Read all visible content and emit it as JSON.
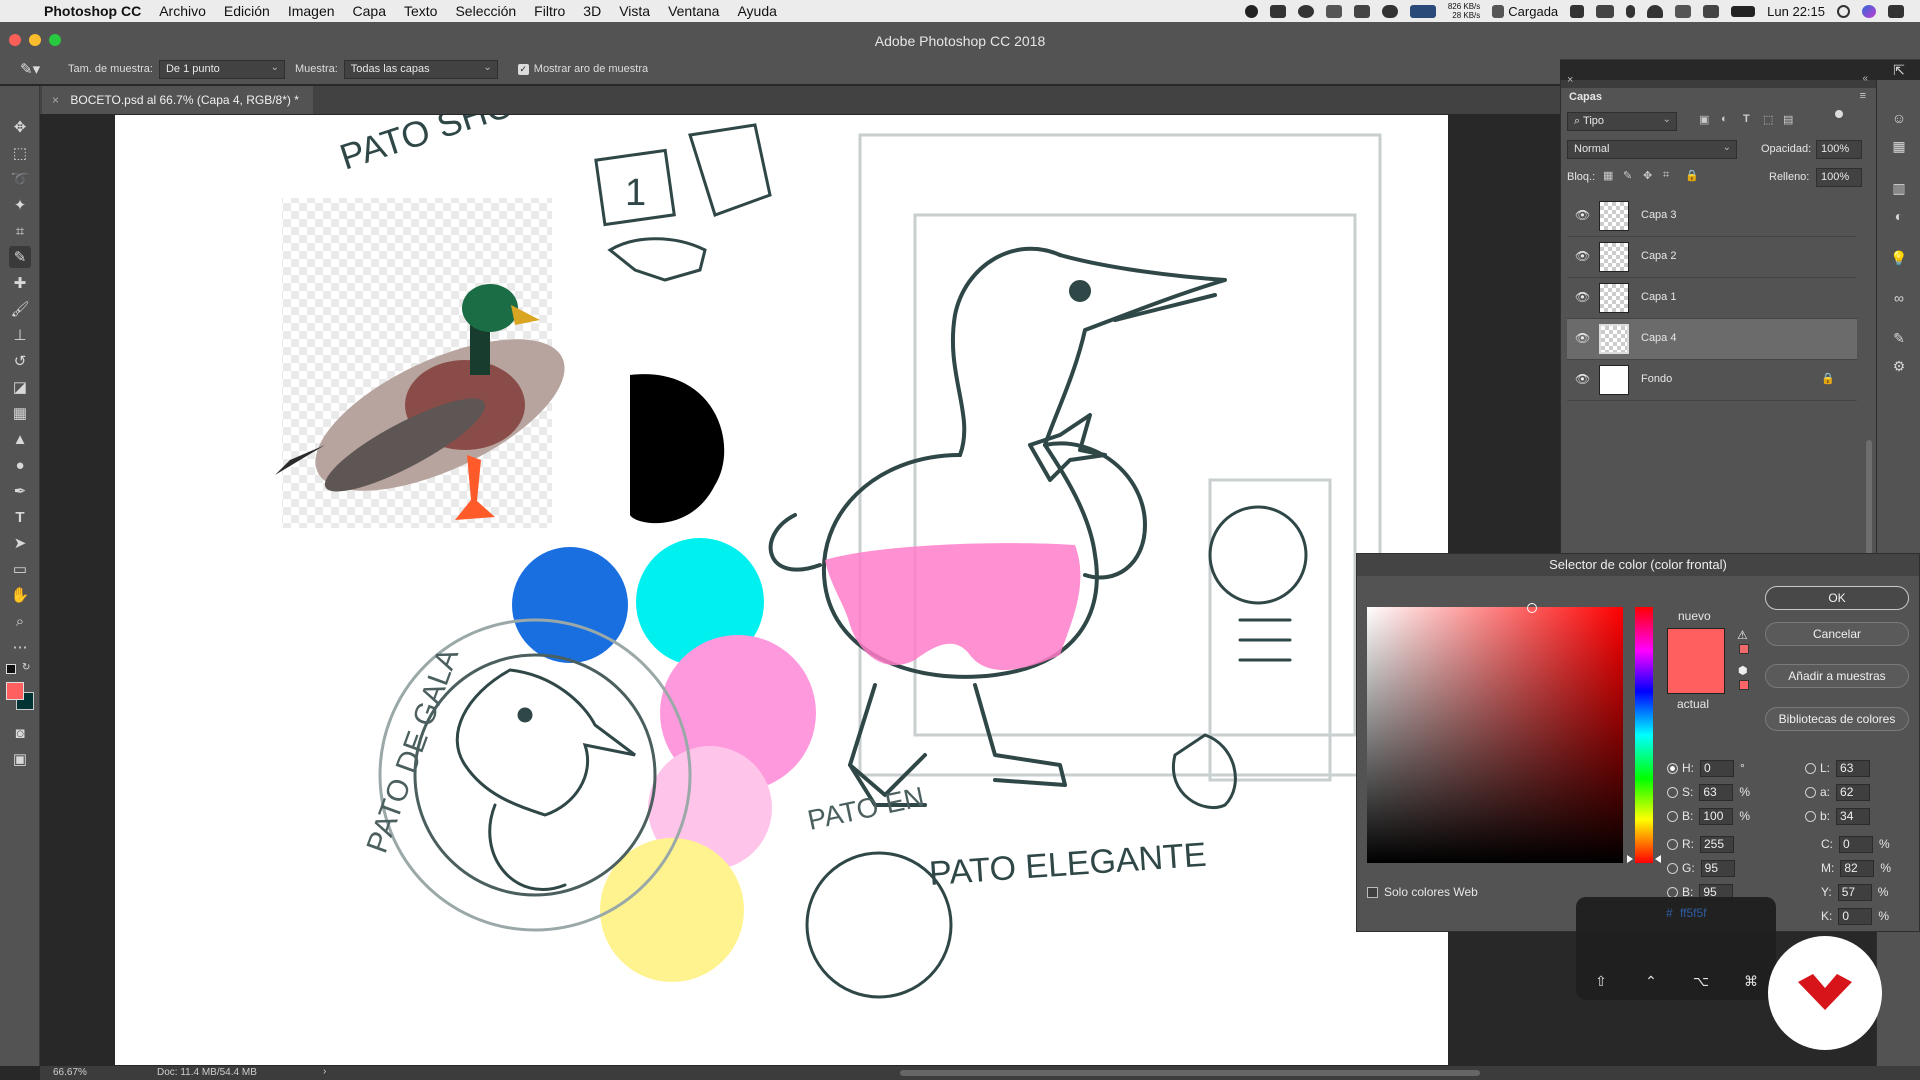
{
  "menubar": {
    "app_name": "Photoshop CC",
    "items": [
      "Archivo",
      "Edición",
      "Imagen",
      "Capa",
      "Texto",
      "Selección",
      "Filtro",
      "3D",
      "Vista",
      "Ventana",
      "Ayuda"
    ],
    "net_up": "826 KB/s",
    "net_down": "28 KB/s",
    "battery_label": "Cargada",
    "clock": "Lun 22:15"
  },
  "window": {
    "title": "Adobe Photoshop CC 2018"
  },
  "options": {
    "sample_size_label": "Tam. de muestra:",
    "sample_size_value": "De 1 punto",
    "sample_label": "Muestra:",
    "sample_value": "Todas las capas",
    "show_ring_label": "Mostrar aro de muestra",
    "show_ring_checked": true
  },
  "document": {
    "tab_title": "BOCETO.psd al 66.7% (Capa 4, RGB/8*) *"
  },
  "canvas_text": {
    "pato_short": "PATO SHORT",
    "pato_gala": "PATO DE GALA",
    "pato_elegante": "PATO ELEGANTE",
    "pato_en": "PATO EN",
    "pato_numero": "1"
  },
  "status": {
    "zoom": "66.67%",
    "doc_info": "Doc: 11.4 MB/54.4 MB"
  },
  "colors": {
    "foreground": "#ff5f5f",
    "background": "#003333",
    "blue": "#1a6fe0",
    "cyan": "#00f0f0",
    "pink": "#ff99dd",
    "light_pink": "#ffc4ea",
    "yellow": "#fff38f",
    "shorts_pink": "#ff7dc9",
    "sketch": "#2f4747"
  },
  "layers_panel": {
    "tab": "Capas",
    "filter": "Tipo",
    "blend_mode": "Normal",
    "opacity_label": "Opacidad:",
    "opacity": "100%",
    "lock_label": "Bloq.:",
    "fill_label": "Relleno:",
    "fill": "100%",
    "layers": [
      {
        "name": "Capa 3",
        "selected": false
      },
      {
        "name": "Capa 2",
        "selected": false
      },
      {
        "name": "Capa 1",
        "selected": false
      },
      {
        "name": "Capa 4",
        "selected": true
      },
      {
        "name": "Fondo",
        "selected": false,
        "locked": true
      }
    ]
  },
  "color_picker": {
    "title": "Selector de color (color frontal)",
    "new_label": "nuevo",
    "current_label": "actual",
    "ok": "OK",
    "cancel": "Cancelar",
    "add_swatch": "Añadir a muestras",
    "libraries": "Bibliotecas de colores",
    "web_only": "Solo colores Web",
    "hex_prefix": "#",
    "hex": "ff5f5f",
    "hsb": {
      "H": "0",
      "S": "63",
      "B": "100"
    },
    "rgb": {
      "R": "255",
      "G": "95",
      "B": "95"
    },
    "lab": {
      "L": "63",
      "a": "62",
      "b": "34"
    },
    "cmyk": {
      "C": "0",
      "M": "82",
      "Y": "57",
      "K": "0"
    },
    "units": {
      "deg": "°",
      "pct": "%"
    }
  },
  "keys": [
    "⇧",
    "⌃",
    "⌥",
    "⌘"
  ]
}
